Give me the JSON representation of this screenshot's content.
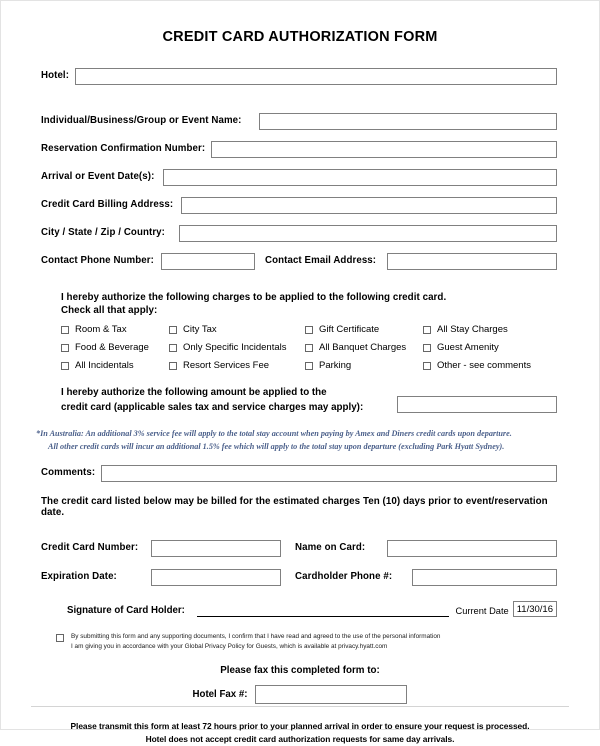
{
  "title": "CREDIT CARD AUTHORIZATION FORM",
  "fields": {
    "hotel": "Hotel:",
    "individual": "Individual/Business/Group or Event  Name:",
    "reservation": "Reservation Confirmation Number:",
    "arrival": "Arrival or Event Date(s):",
    "billing_address": "Credit Card Billing Address:",
    "city_state": "City / State / Zip / Country:",
    "contact_phone": "Contact Phone Number:",
    "contact_email": "Contact Email Address:",
    "comments": "Comments:"
  },
  "authorization": {
    "line1": "I hereby authorize the following charges to be applied to the following credit card.",
    "line2": "Check all that apply:",
    "checkboxes": [
      "Room & Tax",
      "City Tax",
      "Gift Certificate",
      "All Stay Charges",
      "Food & Beverage",
      "Only Specific Incidentals",
      "All Banquet Charges",
      "Guest Amenity",
      "All Incidentals",
      "Resort Services Fee",
      "Parking",
      "Other - see comments"
    ],
    "amount_line1": "I hereby authorize the following amount be applied to the",
    "amount_line2": "credit card (applicable sales tax and service charges may apply):"
  },
  "australia_note": {
    "line1": "*In Australia:  An additional 3% service fee will apply to the total stay account when paying by  Amex and Diners credit cards upon departure.",
    "line2": "All other credit cards will incur an additional 1.5% fee which will apply to the total stay upon departure (excluding Park Hyatt Sydney)."
  },
  "billing_note": "The credit card listed below may be billed for the estimated charges Ten (10) days prior to event/reservation date.",
  "credit_card": {
    "number_label": "Credit Card Number:",
    "name_label": "Name on Card:",
    "expiration_label": "Expiration Date:",
    "cardholder_phone_label": "Cardholder Phone #:",
    "signature_label": "Signature of Card Holder:",
    "current_date_label": "Current Date",
    "current_date_value": "11/30/16"
  },
  "consent": {
    "line1": "By submitting this form and any supporting documents, I confirm that I have read and agreed to the use of the personal information",
    "line2": "I am giving you in accordance with your Global Privacy Policy for Guests, which is available at privacy.hyatt.com"
  },
  "fax": {
    "heading": "Please fax this completed form to:",
    "label": "Hotel Fax #:"
  },
  "footer": {
    "line1": "Please transmit this form at least 72 hours prior to your planned arrival in order to ensure your request is processed.",
    "line2": "Hotel does not accept credit card authorization requests for same day arrivals."
  },
  "colors": {
    "note_blue": "#4a5f8a",
    "box_border": "#808080",
    "text": "#000000"
  }
}
